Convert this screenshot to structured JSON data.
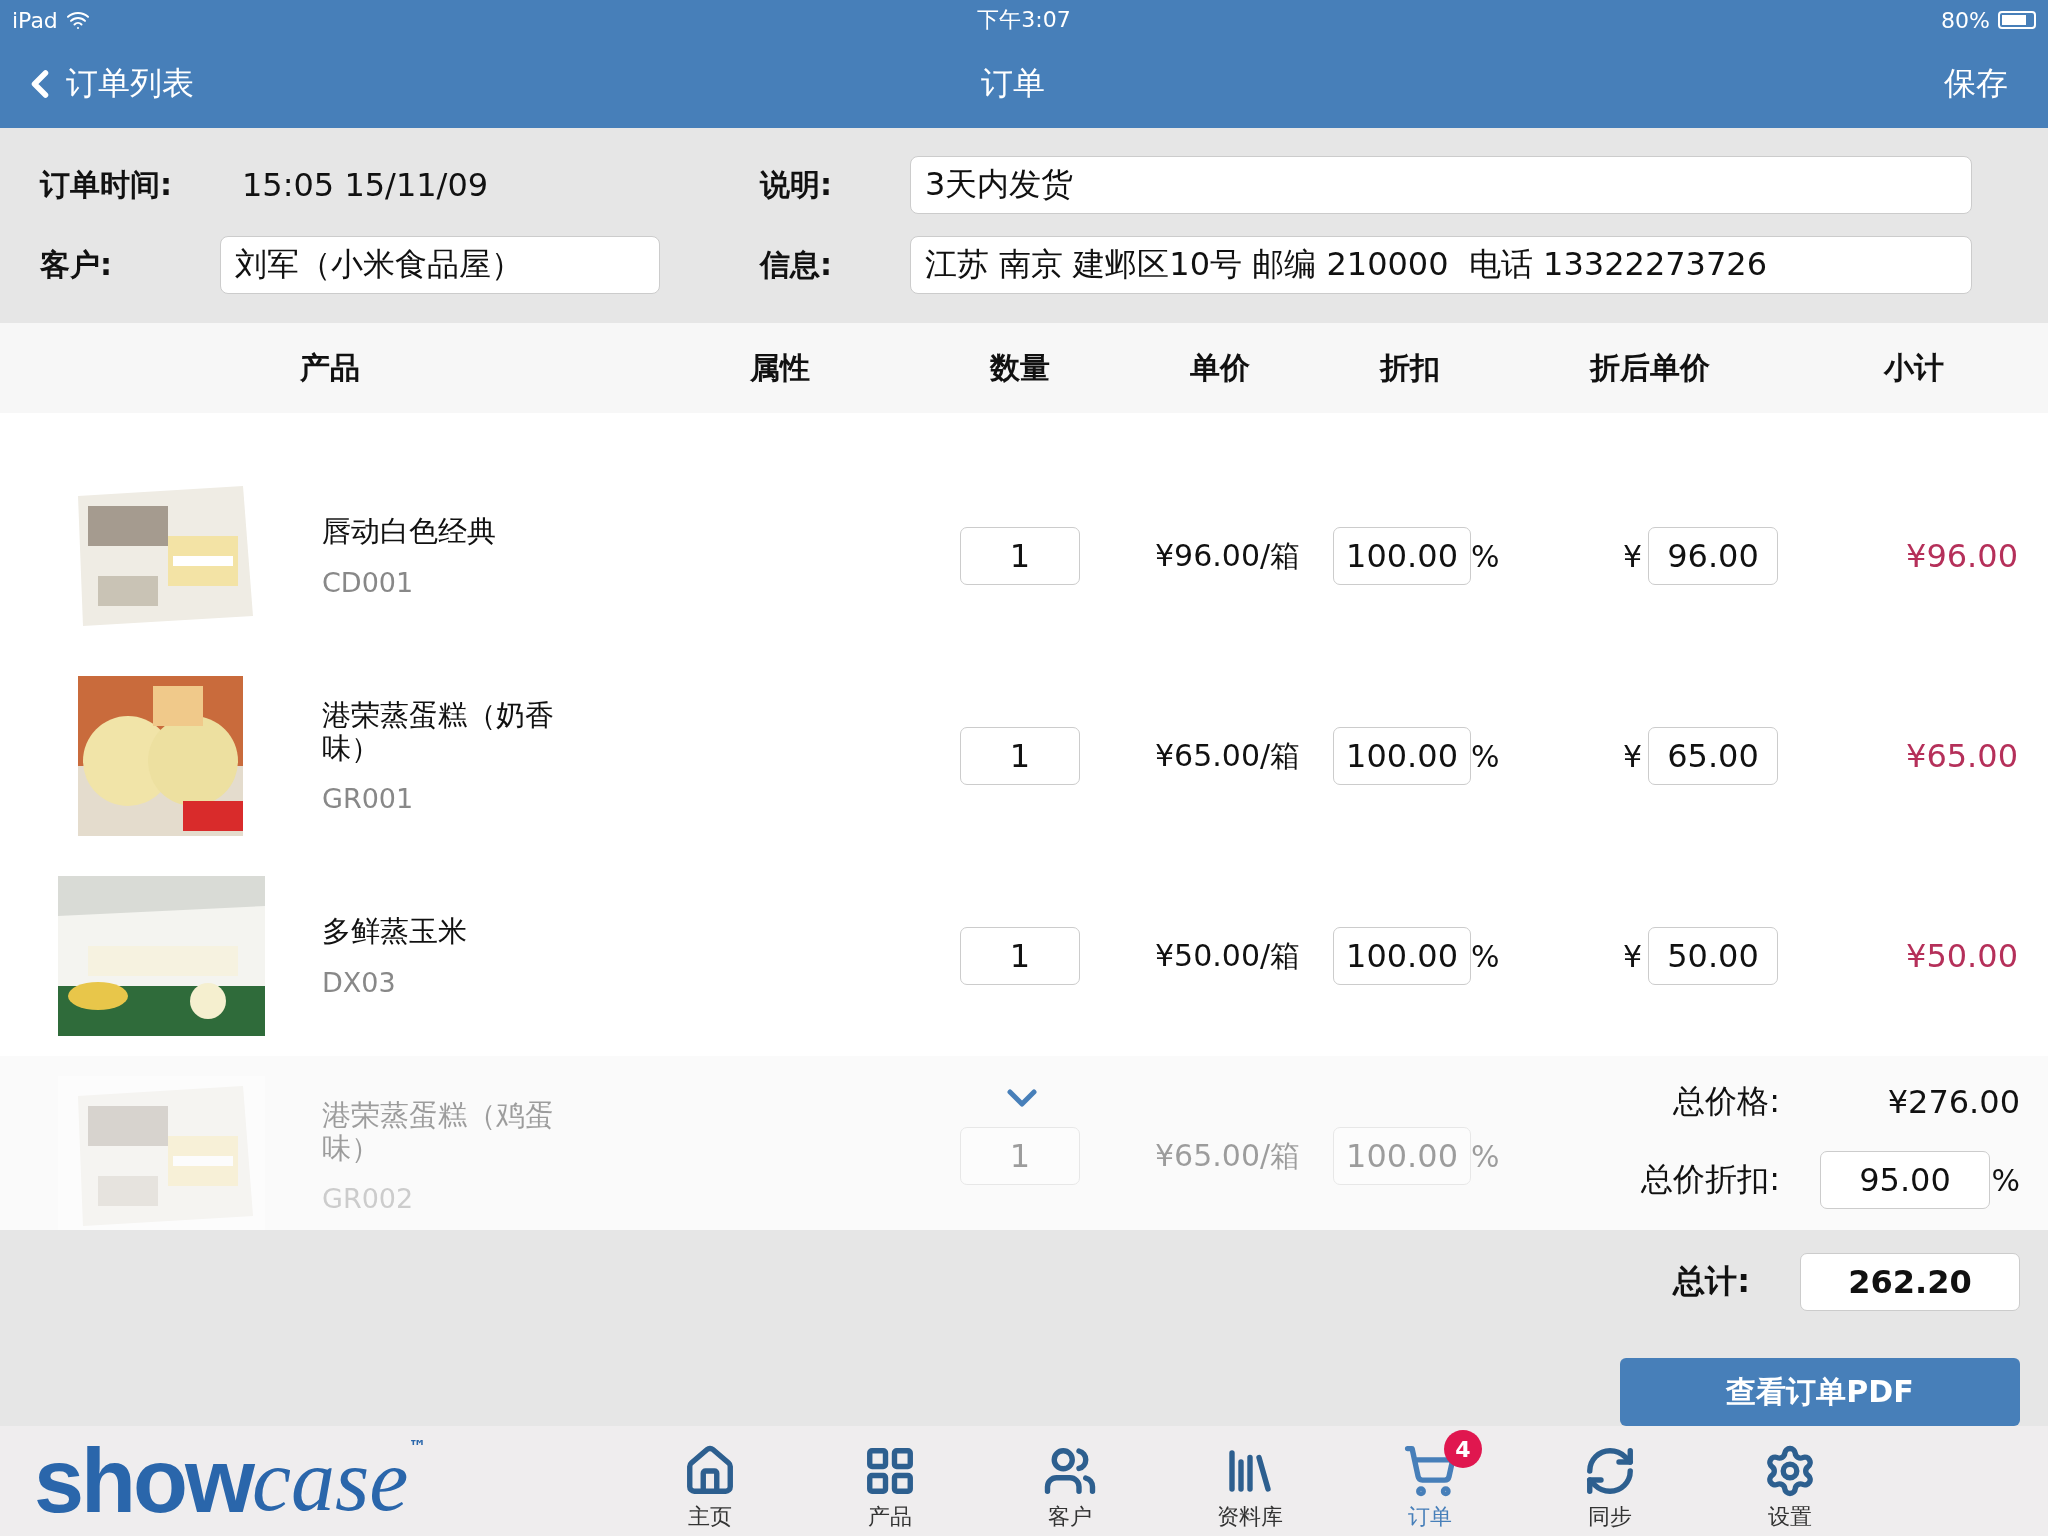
{
  "status_bar": {
    "device": "iPad",
    "time": "下午3:07",
    "battery": "80%"
  },
  "nav": {
    "back": "订单列表",
    "title": "订单",
    "action": "保存"
  },
  "form": {
    "time_label": "订单时间:",
    "time_value": "15:05 15/11/09",
    "note_label": "说明:",
    "note_value": "3天内发货",
    "customer_label": "客户:",
    "customer_value": "刘军（小米食品屋）",
    "info_label": "信息:",
    "info_value": "江苏 南京 建邺区10号 邮编 210000  电话 13322273726"
  },
  "table": {
    "columns": [
      "产品",
      "属性",
      "数量",
      "单价",
      "折扣",
      "折后单价",
      "小计"
    ],
    "rows": [
      {
        "name": "唇动白色经典",
        "code": "CD001",
        "qty": "1",
        "unit_price": "¥96.00/箱",
        "discount": "100.00",
        "percent": "%",
        "currency": "¥",
        "final_price": "96.00",
        "subtotal": "¥96.00",
        "faded": false
      },
      {
        "name": "港荣蒸蛋糕（奶香味）",
        "code": "GR001",
        "qty": "1",
        "unit_price": "¥65.00/箱",
        "discount": "100.00",
        "percent": "%",
        "currency": "¥",
        "final_price": "65.00",
        "subtotal": "¥65.00",
        "faded": false
      },
      {
        "name": "多鲜蒸玉米",
        "code": "DX03",
        "qty": "1",
        "unit_price": "¥50.00/箱",
        "discount": "100.00",
        "percent": "%",
        "currency": "¥",
        "final_price": "50.00",
        "subtotal": "¥50.00",
        "faded": false
      },
      {
        "name": "港荣蒸蛋糕（鸡蛋味）",
        "code": "GR002",
        "qty": "1",
        "unit_price": "¥65.00/箱",
        "discount": "100.00",
        "percent": "%",
        "faded": true
      }
    ]
  },
  "totals": {
    "price_label": "总价格:",
    "price_value": "¥276.00",
    "discount_label": "总价折扣:",
    "discount_value": "95.00",
    "percent": "%",
    "total_label": "总计:",
    "total_value": "262.20",
    "pdf_button": "查看订单PDF"
  },
  "logo": {
    "bold": "show",
    "script": "case",
    "mark": "™"
  },
  "tabbar": [
    {
      "label": "主页",
      "selected": false
    },
    {
      "label": "产品",
      "selected": false
    },
    {
      "label": "客户",
      "selected": false
    },
    {
      "label": "资料库",
      "selected": false
    },
    {
      "label": "订单",
      "selected": true,
      "badge": "4"
    },
    {
      "label": "同步",
      "selected": false
    },
    {
      "label": "设置",
      "selected": false
    }
  ]
}
